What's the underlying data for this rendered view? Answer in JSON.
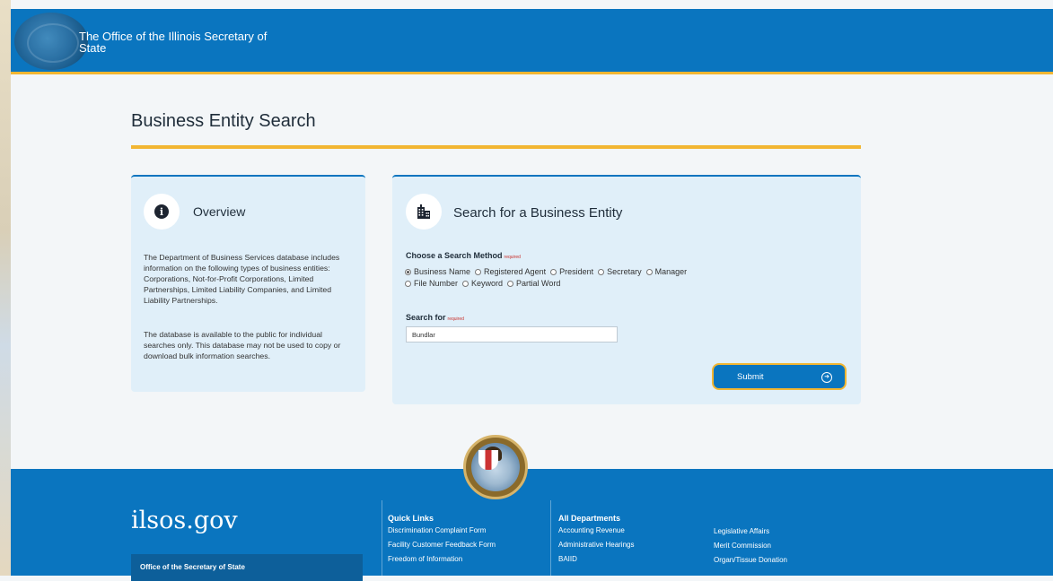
{
  "header": {
    "org_name": "The Office of the Illinois Secretary of State"
  },
  "page": {
    "title": "Business Entity Search"
  },
  "overview": {
    "heading": "Overview",
    "paragraph1": "The Department of Business Services database includes information on the following types of business entities: Corporations, Not-for-Profit Corporations, Limited Partnerships, Limited Liability Companies, and Limited Liability Partnerships.",
    "paragraph2": "The database is available to the public for individual searches only. This database may not be used to copy or download bulk information searches."
  },
  "search": {
    "heading": "Search for a Business Entity",
    "method_label": "Choose a Search Method",
    "required_tag": "required",
    "methods_row1": [
      "Business Name",
      "Registered Agent",
      "President",
      "Secretary",
      "Manager"
    ],
    "methods_row2": [
      "File Number",
      "Keyword",
      "Partial Word"
    ],
    "selected_method": "Business Name",
    "search_for_label": "Search for",
    "search_value": "Bundlar",
    "submit_label": "Submit"
  },
  "footer": {
    "brand": "ilsos.gov",
    "office_title": "Office of the Secretary of State",
    "quick_links": {
      "heading": "Quick Links",
      "items": [
        "Discrimination Complaint Form",
        "Facility Customer Feedback Form",
        "Freedom of Information"
      ]
    },
    "departments": {
      "heading": "All Departments",
      "col1": [
        "Accounting Revenue",
        "Administrative Hearings",
        "BAIID"
      ],
      "col2": [
        "Legislative Affairs",
        "Merit Commission",
        "Organ/Tissue Donation"
      ]
    }
  },
  "colors": {
    "primary_blue": "#0a75bf",
    "accent_gold": "#f2b632",
    "card_bg": "#e0eff9"
  }
}
